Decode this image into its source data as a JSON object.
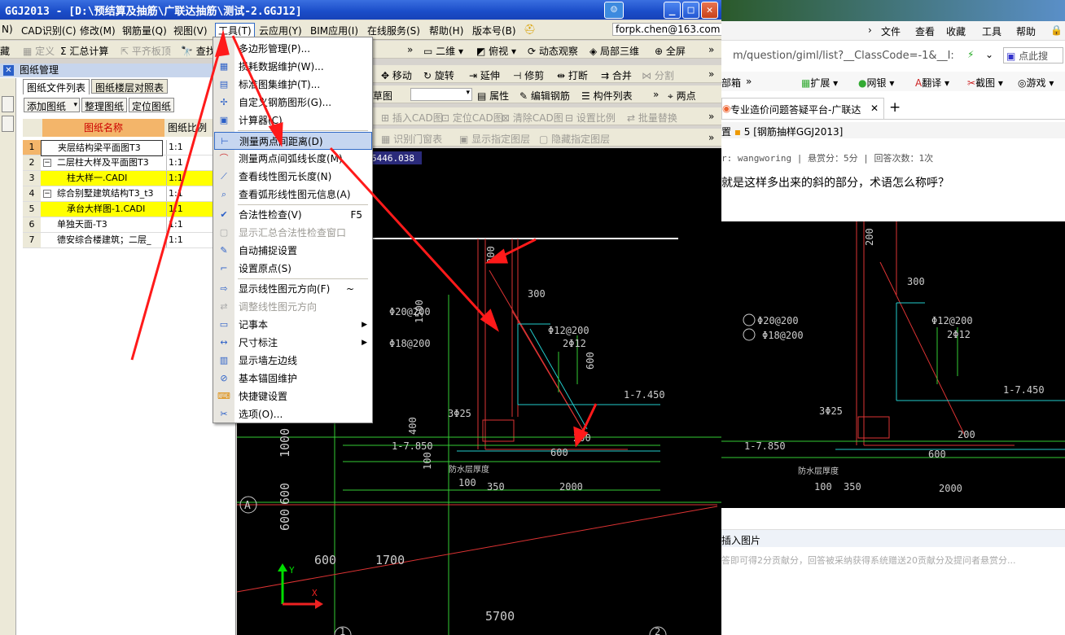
{
  "window": {
    "title": "GGJ2013 - [D:\\预结算及抽筋\\广联达抽筋\\测试-2.GGJ12]"
  },
  "menubar": {
    "items": [
      "N)",
      "CAD识别(C)",
      "修改(M)",
      "钢筋量(Q)",
      "视图(V)",
      "工具(T)",
      "云应用(Y)",
      "BIM应用(I)",
      "在线服务(S)",
      "帮助(H)",
      "版本号(B)"
    ],
    "account": "forpk.chen@163.com"
  },
  "toolbar1": {
    "items": [
      "藏",
      "定义",
      "汇总计算",
      "平齐板顶",
      "查找"
    ]
  },
  "toolbar_right1": {
    "items": [
      "二维",
      "俯视",
      "动态观察",
      "局部三维",
      "全屏"
    ]
  },
  "toolbar_right2": {
    "items": [
      "移动",
      "旋转",
      "延伸",
      "修剪",
      "打断",
      "合并",
      "分割"
    ]
  },
  "toolbar_right3": {
    "items": [
      "草图",
      "属性",
      "编辑钢筋",
      "构件列表",
      "两点"
    ]
  },
  "toolbar_right4": {
    "items": [
      "插入CAD图",
      "定位CAD图",
      "清除CAD图",
      "设置比例",
      "批量替换"
    ]
  },
  "toolbar_right5": {
    "items": [
      "识别门窗表",
      "显示指定图层",
      "隐藏指定图层"
    ]
  },
  "coord_readout": "5446.038",
  "left_panel": {
    "title": "图纸管理",
    "tabs": [
      "图纸文件列表",
      "图纸楼层对照表"
    ],
    "buttons": [
      "添加图纸",
      "整理图纸",
      "定位图纸"
    ],
    "columns": [
      "图纸名称",
      "图纸比例"
    ],
    "rows": [
      {
        "n": "1",
        "name": "夹层结构梁平面图T3",
        "scale": "1:1"
      },
      {
        "n": "2",
        "name": "二层柱大样及平面图T3",
        "scale": "1:1"
      },
      {
        "n": "3",
        "name": "柱大样一.CADI",
        "scale": "1:1"
      },
      {
        "n": "4",
        "name": "综合别墅建筑结构T3_t3",
        "scale": "1:1"
      },
      {
        "n": "5",
        "name": "承台大样图-1.CADI",
        "scale": "1:1"
      },
      {
        "n": "6",
        "name": "单独天面-T3",
        "scale": "1:1"
      },
      {
        "n": "7",
        "name": "德安综合楼建筑；二层_",
        "scale": "1:1"
      }
    ]
  },
  "context_menu": {
    "items": [
      {
        "label": "多边形管理(P)...",
        "icon": "polygon-icon"
      },
      {
        "label": "损耗数据维护(W)...",
        "icon": "table-icon"
      },
      {
        "label": "标准图集维护(T)...",
        "icon": "book-icon"
      },
      {
        "label": "自定义钢筋图形(G)...",
        "icon": "shape-icon"
      },
      {
        "label": "计算器(C)",
        "icon": "calculator-icon"
      },
      {
        "label": "测量两点间距离(D)",
        "icon": "ruler-icon"
      },
      {
        "label": "测量两点间弧线长度(M)",
        "icon": "arc-icon"
      },
      {
        "label": "查看线性图元长度(N)",
        "icon": "line-icon"
      },
      {
        "label": "查看弧形线性图元信息(A)",
        "icon": "magnify-icon"
      },
      {
        "label": "合法性检查(V)",
        "shortcut": "F5",
        "icon": "check-icon"
      },
      {
        "label": "显示汇总合法性检查窗口",
        "icon": "window-icon"
      },
      {
        "label": "自动捕捉设置",
        "icon": "snap-icon"
      },
      {
        "label": "设置原点(S)",
        "icon": "origin-icon"
      },
      {
        "label": "显示线性图元方向(F)",
        "shortcut": "~",
        "icon": "arrow-icon"
      },
      {
        "label": "调整线性图元方向",
        "icon": "adjust-icon"
      },
      {
        "label": "记事本",
        "icon": "notepad-icon"
      },
      {
        "label": "尺寸标注",
        "icon": "dimension-icon"
      },
      {
        "label": "显示墙左边线",
        "icon": "wall-icon"
      },
      {
        "label": "基本锚固维护",
        "icon": "anchor-icon"
      },
      {
        "label": "快捷键设置",
        "icon": "keyboard-icon"
      },
      {
        "label": "选项(O)...",
        "icon": "options-icon"
      }
    ]
  },
  "cad": {
    "labels": [
      "Φ20@200",
      "Φ18@200",
      "Φ12@200",
      "2Φ12",
      "300",
      "600",
      "1-7.450",
      "3Φ25",
      "1-7.850",
      "600",
      "防水层厚度",
      "100",
      "350",
      "2000",
      "200",
      "1500",
      "200",
      "400",
      "100"
    ],
    "axis": {
      "bottom1": "600",
      "bottom2": "1700",
      "bottom3": "5700",
      "left1": "1000",
      "left2": "600",
      "left3": "600",
      "grid_a": "A",
      "grid_1": "1",
      "grid_2": "2",
      "x": "X",
      "y": "Y"
    }
  },
  "browser": {
    "toolbar": [
      "文件",
      "查看",
      "收藏",
      "工具",
      "帮助"
    ],
    "url": "m/question/giml/list?__ClassCode=-1&__I:",
    "search": "点此搜",
    "links": [
      "部箱",
      "扩展",
      "网银",
      "翻译",
      "截图",
      "游戏"
    ],
    "tab_title": "专业造价问题答疑平台-广联达",
    "breadcrumb": "5 [钢筋抽样GGJ2013]",
    "meta": "r: wangworing  |  悬赏分：5分  |  回答次数：1次",
    "question": "就是这样多出来的斜的部分，术语怎么称呼？",
    "insert": "插入图片",
    "footer": "答即可得2分贡献分，回答被采纳获得系统赠送20贡献分及提问者悬赏分..."
  },
  "colors": {
    "red": "#ff1a1a",
    "cad_bg": "#000000",
    "highlight": "#ffff00",
    "title": "#1a4cc8"
  }
}
